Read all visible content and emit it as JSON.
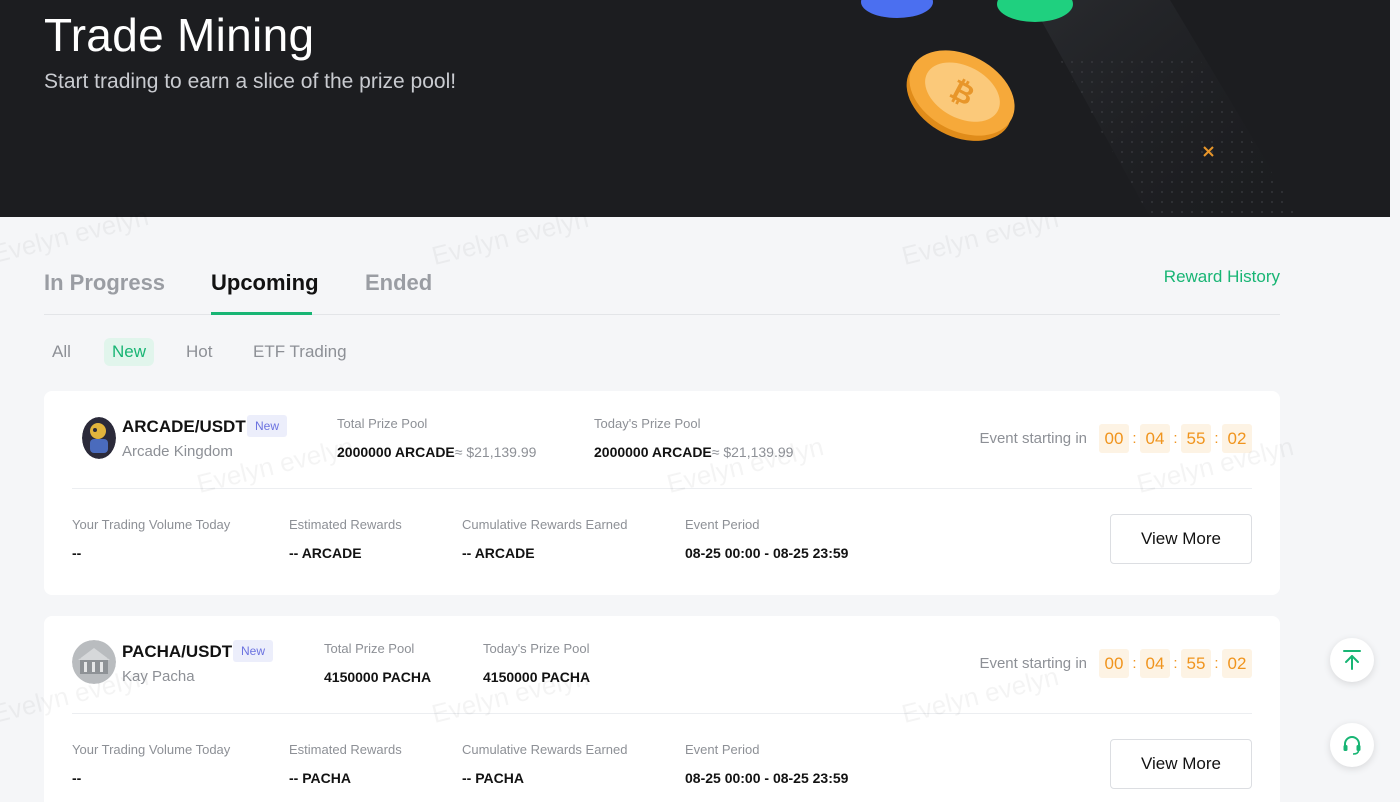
{
  "hero": {
    "title": "Trade Mining",
    "subtitle": "Start trading to earn a slice of the prize pool!"
  },
  "tabs": [
    {
      "label": "In Progress",
      "active": false
    },
    {
      "label": "Upcoming",
      "active": true
    },
    {
      "label": "Ended",
      "active": false
    }
  ],
  "reward_history_label": "Reward History",
  "filters": [
    {
      "label": "All",
      "active": false
    },
    {
      "label": "New",
      "active": true
    },
    {
      "label": "Hot",
      "active": false
    },
    {
      "label": "ETF Trading",
      "active": false
    }
  ],
  "labels": {
    "total_prize_pool": "Total Prize Pool",
    "todays_prize_pool": "Today's Prize Pool",
    "event_starting_in": "Event starting in",
    "your_trading_volume": "Your Trading Volume Today",
    "estimated_rewards": "Estimated Rewards",
    "cumulative_rewards": "Cumulative Rewards Earned",
    "event_period": "Event Period",
    "view_more": "View More",
    "new_badge": "New",
    "timer_sep": ":"
  },
  "events": [
    {
      "pair": "ARCADE/USDT",
      "name": "Arcade Kingdom",
      "total_prize": "2000000 ARCADE",
      "total_prize_usd": "≈ $21,139.99",
      "today_prize": "2000000 ARCADE",
      "today_prize_usd": "≈ $21,139.99",
      "countdown": [
        "00",
        "04",
        "55",
        "02"
      ],
      "trading_volume": "--",
      "estimated_rewards": "-- ARCADE",
      "cumulative_rewards": "-- ARCADE",
      "event_period": "08-25 00:00 - 08-25 23:59"
    },
    {
      "pair": "PACHA/USDT",
      "name": "Kay Pacha",
      "total_prize": "4150000 PACHA",
      "today_prize": "4150000 PACHA",
      "countdown": [
        "00",
        "04",
        "55",
        "02"
      ],
      "trading_volume": "--",
      "estimated_rewards": "-- PACHA",
      "cumulative_rewards": "-- PACHA",
      "event_period": "08-25 00:00 - 08-25 23:59"
    }
  ],
  "watermark": "Evelyn evelyn",
  "colors": {
    "accent": "#18b574",
    "timer": "#f0941d",
    "badge": "#6b72e0",
    "hero_bg": "#1c1d20"
  },
  "icons": {
    "scroll_top": "arrow-up-to-line-icon",
    "support": "headset-icon"
  }
}
